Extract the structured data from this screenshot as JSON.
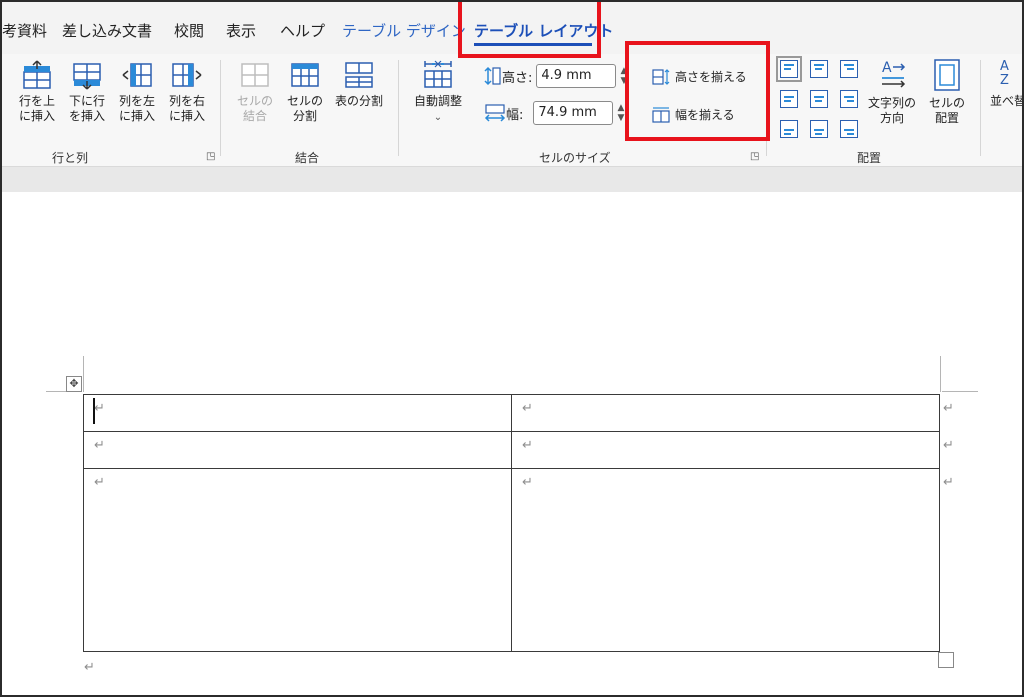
{
  "tabs": {
    "references_partial": "考資料",
    "mailings": "差し込み文書",
    "review": "校閲",
    "view": "表示",
    "help": "ヘルプ",
    "table_design": "テーブル デザイン",
    "table_layout": "テーブル レイアウト"
  },
  "rows_columns": {
    "insert_above": [
      "行を上",
      "に挿入"
    ],
    "insert_below": [
      "下に行",
      "を挿入"
    ],
    "insert_left": [
      "列を左",
      "に挿入"
    ],
    "insert_right": [
      "列を右",
      "に挿入"
    ],
    "group_label": "行と列"
  },
  "merge": {
    "merge_cells": [
      "セルの",
      "結合"
    ],
    "split_cells": [
      "セルの",
      "分割"
    ],
    "split_table": "表の分割",
    "group_label": "結合"
  },
  "cell_size": {
    "autofit": "自動調整",
    "height_label": "高さ:",
    "height_value": "4.9 mm",
    "width_label": "幅:",
    "width_value": "74.9 mm",
    "distribute_rows": "高さを揃える",
    "distribute_columns": "幅を揃える",
    "group_label": "セルのサイズ"
  },
  "alignment": {
    "text_direction": [
      "文字列の",
      "方向"
    ],
    "cell_margins": [
      "セルの",
      "配置"
    ],
    "group_label": "配置"
  },
  "data": {
    "sort": "並べ替え",
    "sort_icon_letters": "A Z"
  },
  "document": {
    "paragraph_mark": "↵",
    "table": {
      "rows": [
        [
          "↵",
          "↵"
        ],
        [
          "↵",
          "↵"
        ],
        [
          "↵",
          "↵"
        ]
      ],
      "row_end_mark": "↵"
    }
  },
  "colors": {
    "accent": "#1c4fb8",
    "highlight": "#e8131c",
    "icon_blue": "#2b8ad8"
  }
}
